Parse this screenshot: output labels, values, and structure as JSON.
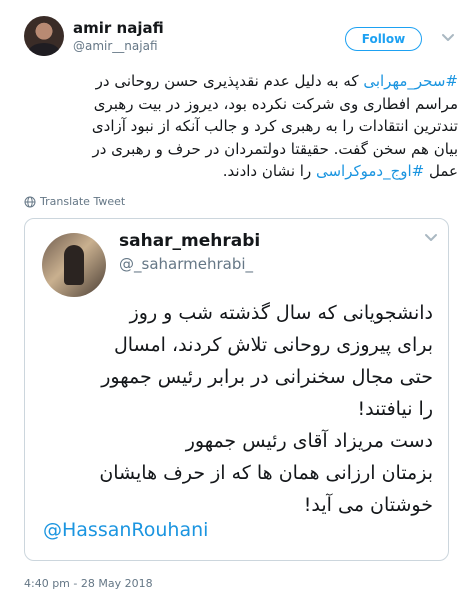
{
  "author": {
    "name": "amir najafi",
    "handle": "@amir__najafi",
    "avatar_icon": "profile-photo"
  },
  "follow_label": "Follow",
  "tweet": {
    "line1_hashtag": "#سحر_مهرابی",
    "line1_rest": " که به دلیل عدم نقدپذیری حسن روحانی در",
    "line2": "مراسم افطاری وی شرکت نکرده بود، دیروز در بیت رهبری",
    "line3": "تندترین انتقادات را به رهبری کرد و جالب آنکه از نبود آزادی",
    "line4": "بیان هم سخن گفت. حقیقتا دولتمردان در حرف و رهبری در",
    "line5_start": "عمل ",
    "line5_hashtag": "#اوج_دموکراسی",
    "line5_end": " را نشان دادند."
  },
  "translate_label": "Translate Tweet",
  "quoted": {
    "name": "sahar_mehrabi",
    "handle": "@_saharmehrabi_",
    "lines": [
      "دانشجویانی که سال گذشته شب و روز",
      "برای پیروزی روحانی تلاش کردند، امسال",
      "حتی مجال سخنرانی در برابر رئیس جمهور",
      "را نیافتند!",
      "دست مریزاد آقای رئیس جمهور",
      "بزمتان ارزانی همان ها که از حرف هایشان",
      "خوشتان می آید!"
    ],
    "mention": "@HassanRouhani"
  },
  "timestamp": "4:40 pm - 28 May 2018",
  "colors": {
    "link": "#1b95e0",
    "muted": "#657786",
    "border": "#ccd6dd",
    "follow": "#1da1f2"
  }
}
